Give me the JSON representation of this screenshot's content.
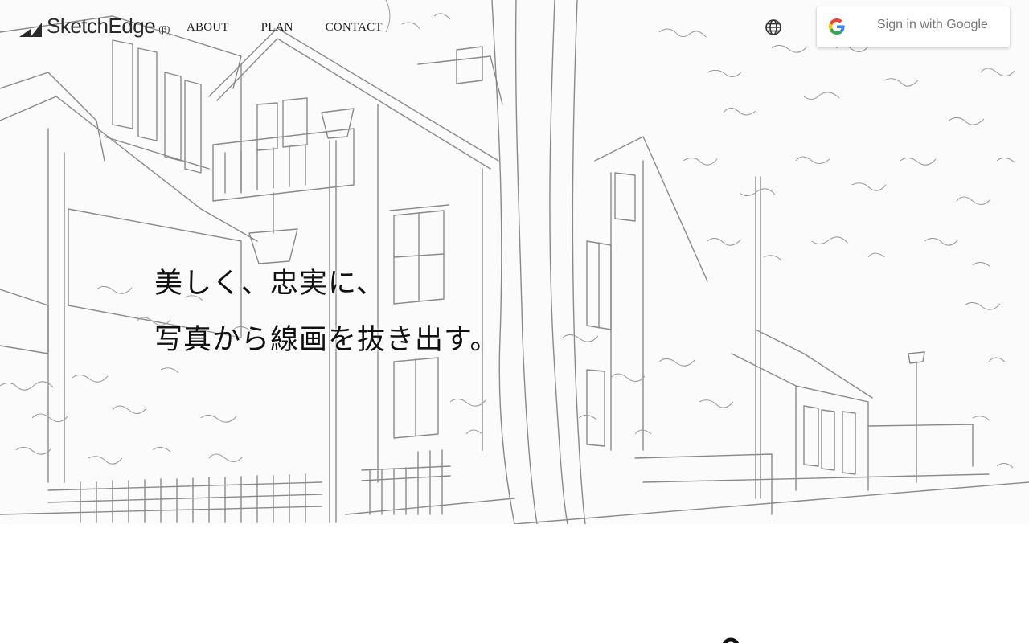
{
  "brand": {
    "name": "SketchEdge",
    "beta": "(β)"
  },
  "nav": {
    "items": [
      {
        "label": "ABOUT"
      },
      {
        "label": "PLAN"
      },
      {
        "label": "CONTACT"
      }
    ]
  },
  "header": {
    "language_icon": "globe-icon",
    "signin": {
      "label": "Sign in with Google",
      "icon": "google-g-icon"
    }
  },
  "hero": {
    "background": "line-drawing-street-scene",
    "headline_line1": "美しく、忠実に、",
    "headline_line2": "写真から線画を抜き出す。"
  },
  "colors": {
    "text": "#111111",
    "sketch_stroke": "#8a8a8a",
    "signin_text": "#757575",
    "google_blue": "#4285F4",
    "google_red": "#EA4335",
    "google_yellow": "#FBBC05",
    "google_green": "#34A853"
  }
}
